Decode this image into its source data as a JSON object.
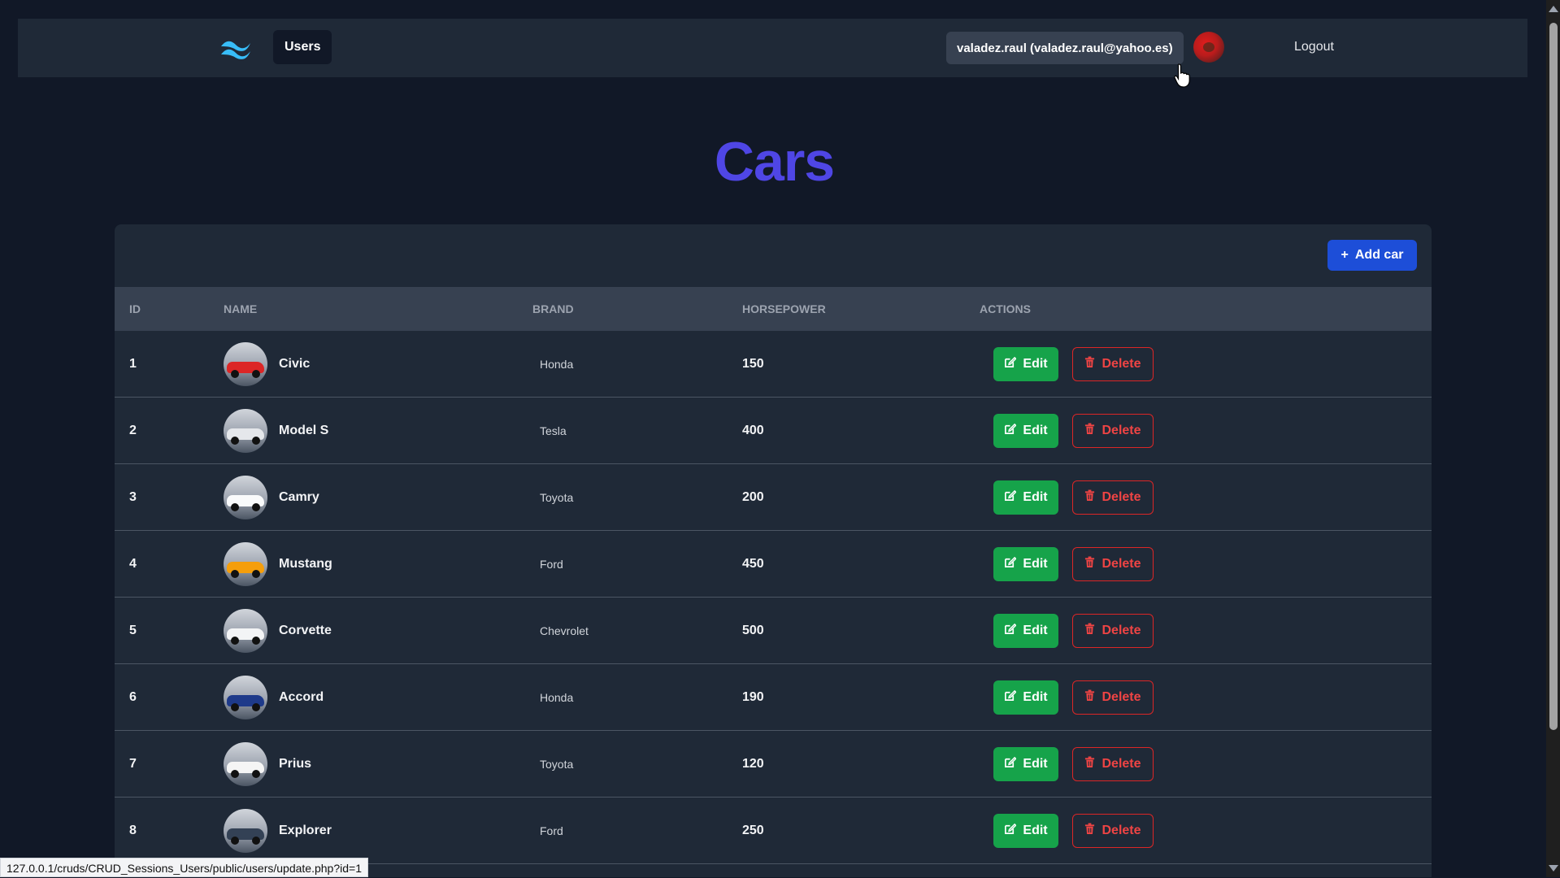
{
  "navbar": {
    "users_label": "Users",
    "user_chip": "valadez.raul (valadez.raul@yahoo.es)",
    "logout_label": "Logout"
  },
  "page": {
    "title": "Cars"
  },
  "toolbar": {
    "add_label": "Add car"
  },
  "table": {
    "headers": {
      "id": "ID",
      "name": "NAME",
      "brand": "BRAND",
      "horsepower": "HORSEPOWER",
      "actions": "ACTIONS"
    },
    "edit_label": "Edit",
    "delete_label": "Delete",
    "rows": [
      {
        "id": "1",
        "name": "Civic",
        "brand": "Honda",
        "horsepower": "150",
        "color": "#dc2626"
      },
      {
        "id": "2",
        "name": "Model S",
        "brand": "Tesla",
        "horsepower": "400",
        "color": "#e5e7eb"
      },
      {
        "id": "3",
        "name": "Camry",
        "brand": "Toyota",
        "horsepower": "200",
        "color": "#f9fafb"
      },
      {
        "id": "4",
        "name": "Mustang",
        "brand": "Ford",
        "horsepower": "450",
        "color": "#f59e0b"
      },
      {
        "id": "5",
        "name": "Corvette",
        "brand": "Chevrolet",
        "horsepower": "500",
        "color": "#f3f4f6"
      },
      {
        "id": "6",
        "name": "Accord",
        "brand": "Honda",
        "horsepower": "190",
        "color": "#1e3a8a"
      },
      {
        "id": "7",
        "name": "Prius",
        "brand": "Toyota",
        "horsepower": "120",
        "color": "#f5f5f5"
      },
      {
        "id": "8",
        "name": "Explorer",
        "brand": "Ford",
        "horsepower": "250",
        "color": "#334155"
      }
    ]
  },
  "status_bar": {
    "url": "127.0.0.1/cruds/CRUD_Sessions_Users/public/users/update.php?id=1"
  }
}
